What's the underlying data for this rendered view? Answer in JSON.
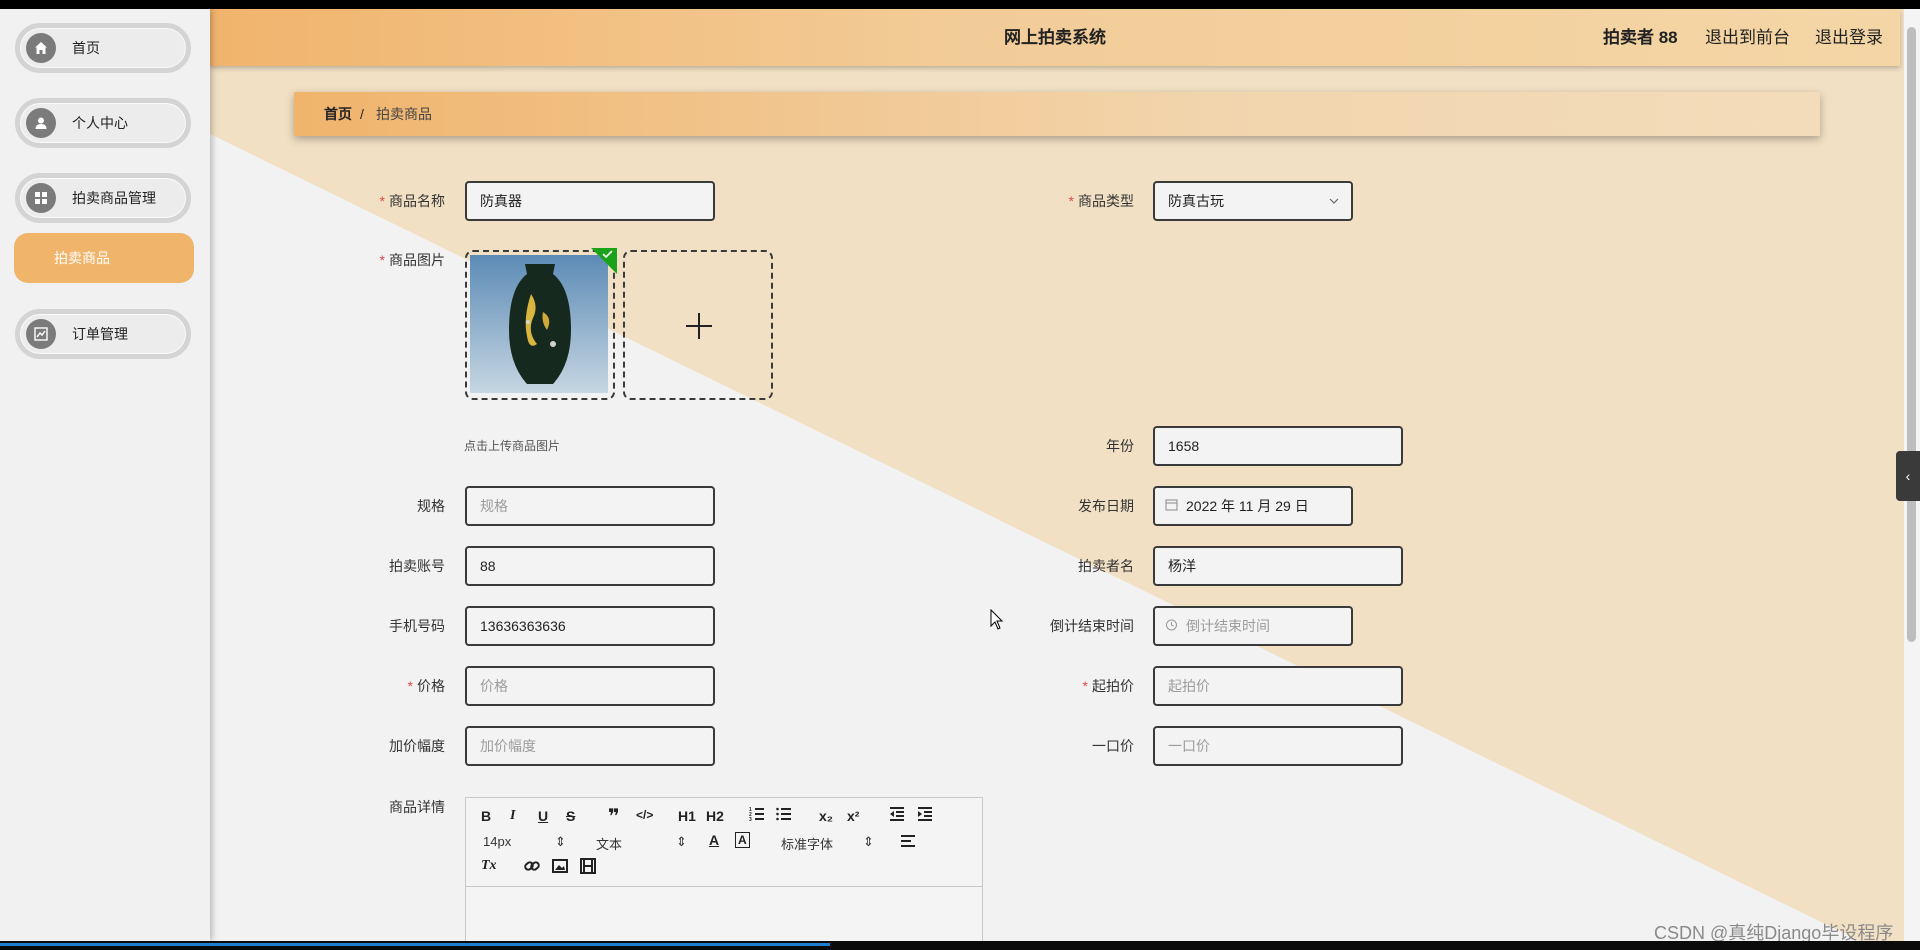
{
  "header": {
    "title": "网上拍卖系统",
    "user_label": "拍卖者 88",
    "front_link": "退出到前台",
    "logout_link": "退出登录"
  },
  "sidebar": {
    "items": [
      {
        "label": "首页",
        "icon": "home-icon"
      },
      {
        "label": "个人中心",
        "icon": "user-icon"
      },
      {
        "label": "拍卖商品管理",
        "icon": "grid-icon"
      },
      {
        "label": "订单管理",
        "icon": "chart-icon"
      }
    ],
    "submenu": {
      "label": "拍卖商品"
    }
  },
  "breadcrumb": {
    "home": "首页",
    "separator": "/",
    "current": "拍卖商品"
  },
  "form": {
    "name": {
      "label": "商品名称",
      "value": "防真器",
      "required": true
    },
    "type": {
      "label": "商品类型",
      "value": "防真古玩",
      "required": true
    },
    "image": {
      "label": "商品图片",
      "hint": "点击上传商品图片",
      "required": true
    },
    "year": {
      "label": "年份",
      "value": "1658"
    },
    "spec": {
      "label": "规格",
      "placeholder": "规格"
    },
    "publish_date": {
      "label": "发布日期",
      "value": "2022 年 11 月 29 日"
    },
    "account": {
      "label": "拍卖账号",
      "value": "88"
    },
    "seller_name": {
      "label": "拍卖者名",
      "value": "杨洋"
    },
    "phone": {
      "label": "手机号码",
      "value": "13636363636"
    },
    "countdown": {
      "label": "倒计结束时间",
      "placeholder": "倒计结束时间"
    },
    "price": {
      "label": "价格",
      "placeholder": "价格",
      "required": true
    },
    "start_price": {
      "label": "起拍价",
      "placeholder": "起拍价",
      "required": true
    },
    "increment": {
      "label": "加价幅度",
      "placeholder": "加价幅度"
    },
    "buyout": {
      "label": "一口价",
      "placeholder": "一口价"
    },
    "detail": {
      "label": "商品详情"
    }
  },
  "editor": {
    "font_size": "14px",
    "text_style": "文本",
    "font_family": "标准字体",
    "buttons": {
      "bold": "B",
      "italic": "I",
      "underline": "U",
      "strike": "S",
      "h1": "H1",
      "h2": "H2",
      "sub": "x₂",
      "sup": "x²",
      "clear": "Tx"
    }
  },
  "watermark": "CSDN @真纯Django毕设程序",
  "colors": {
    "accent": "#f0b46a",
    "required": "#e04848",
    "diag_fill": "#f2e0c4"
  }
}
